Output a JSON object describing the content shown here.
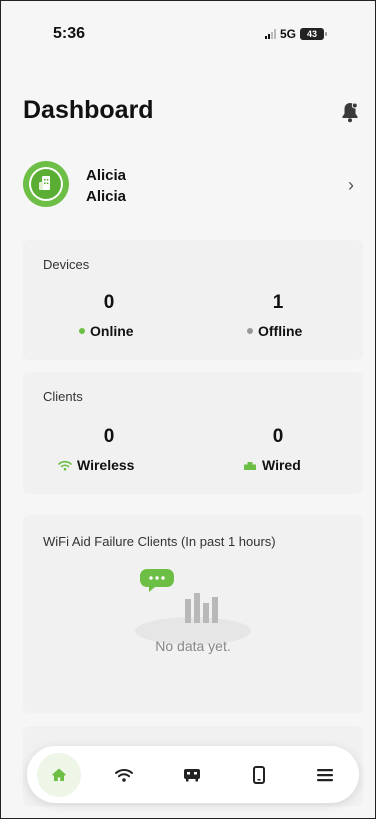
{
  "status_bar": {
    "time": "5:36",
    "network": "5G",
    "battery": "43"
  },
  "header": {
    "title": "Dashboard"
  },
  "profile": {
    "line1": "Alicia",
    "line2": "Alicia"
  },
  "devices": {
    "label": "Devices",
    "online_count": "0",
    "online_label": "Online",
    "offline_count": "1",
    "offline_label": "Offline"
  },
  "clients": {
    "label": "Clients",
    "wireless_count": "0",
    "wireless_label": "Wireless",
    "wired_count": "0",
    "wired_label": "Wired"
  },
  "wifi_aid": {
    "title": "WiFi Aid Failure Clients (In past 1 hours)",
    "empty_text": "No data yet."
  },
  "nav": {
    "items": [
      {
        "icon": "home-icon",
        "active": true
      },
      {
        "icon": "wifi-icon",
        "active": false
      },
      {
        "icon": "router-icon",
        "active": false
      },
      {
        "icon": "phone-icon",
        "active": false
      },
      {
        "icon": "menu-icon",
        "active": false
      }
    ]
  },
  "colors": {
    "accent": "#6cbe45",
    "online": "#6cbe45",
    "offline": "#999999"
  }
}
